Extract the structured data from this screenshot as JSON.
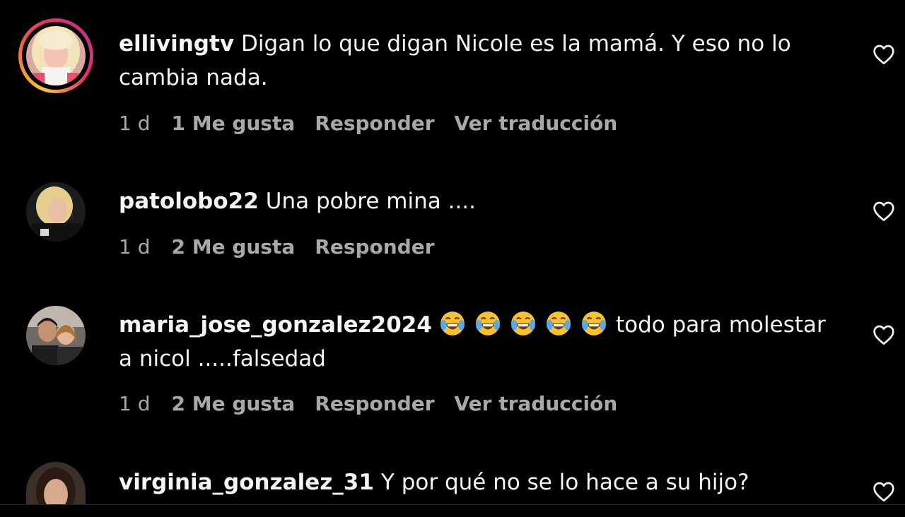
{
  "comments": [
    {
      "username": "ellivingtv",
      "text": "Digan lo que digan Nicole es la mamá. Y eso no lo cambia nada.",
      "time": "1 d",
      "likes": "1 Me gusta",
      "reply": "Responder",
      "translate": "Ver traducción",
      "has_story": true,
      "avatar_icon": "blonde-woman-avatar"
    },
    {
      "username": "patolobo22",
      "text": "Una pobre mina ....",
      "time": "1 d",
      "likes": "2 Me gusta",
      "reply": "Responder",
      "has_story": false,
      "avatar_icon": "blonde-woman-dark-avatar"
    },
    {
      "username": "maria_jose_gonzalez2024",
      "emojis": [
        "😂",
        "😂",
        "😂",
        "😂",
        "😂"
      ],
      "text": "todo para molestar a nicol .....falsedad",
      "time": "1 d",
      "likes": "2 Me gusta",
      "reply": "Responder",
      "translate": "Ver traducción",
      "has_story": false,
      "avatar_icon": "two-people-avatar"
    },
    {
      "username": "virginia_gonzalez_31",
      "text": "Y por qué no se lo hace a su hijo?",
      "has_story": false,
      "avatar_icon": "dark-haired-woman-avatar"
    }
  ],
  "icons": {
    "like": "heart-outline-icon",
    "emoji": "tears-of-joy-emoji"
  },
  "colors": {
    "background": "#000000",
    "text": "#f5f5f5",
    "meta": "#a8a8a8",
    "story_ring": [
      "#fdc830",
      "#f37335",
      "#e1306c",
      "#c13584"
    ]
  }
}
